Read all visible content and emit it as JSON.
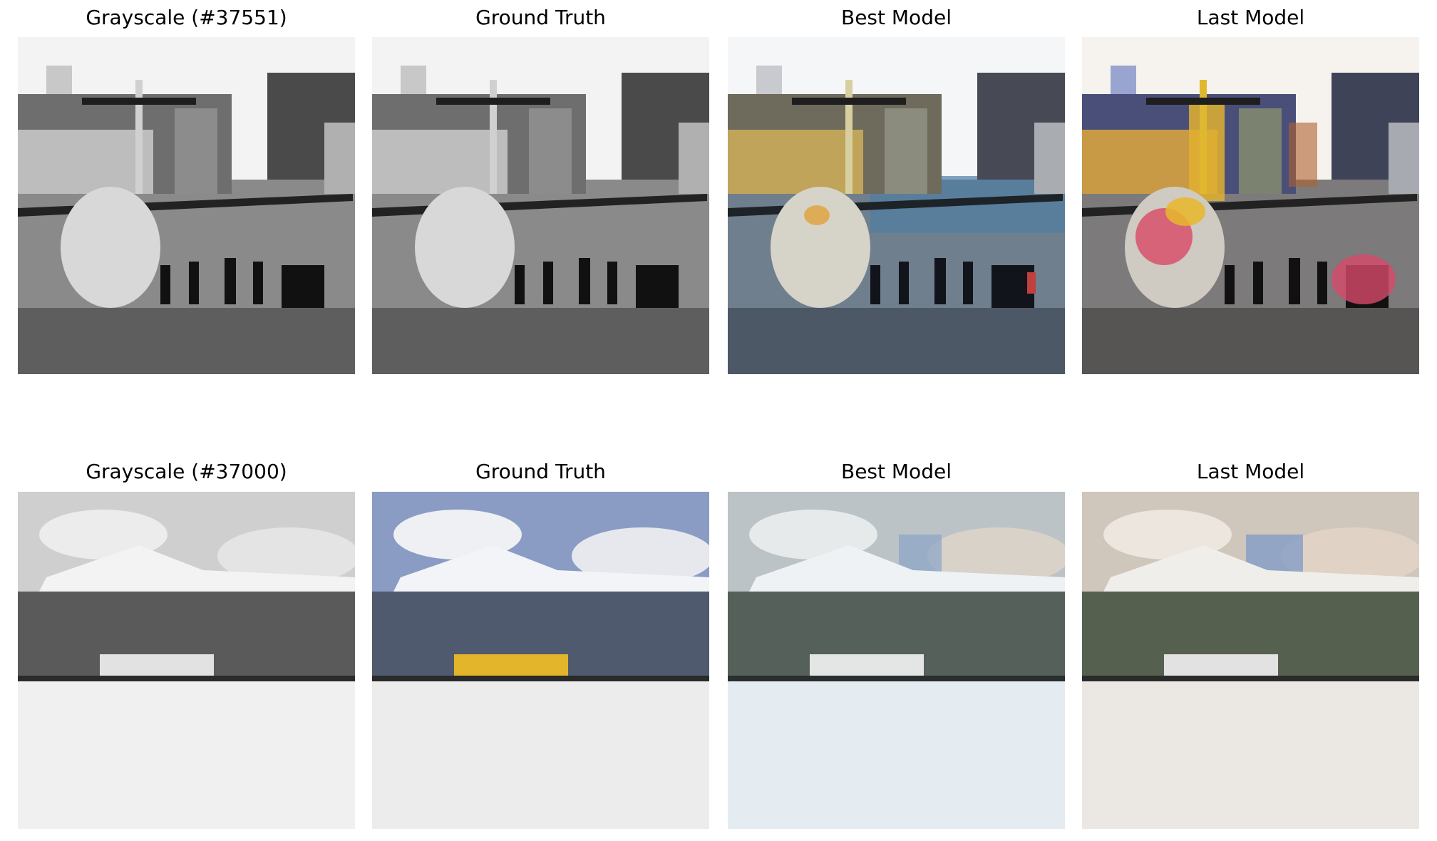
{
  "rows": [
    {
      "panels": [
        {
          "title": "Grayscale (#37551)",
          "variant": "gray"
        },
        {
          "title": "Ground Truth",
          "variant": "gray"
        },
        {
          "title": "Best Model",
          "variant": "best"
        },
        {
          "title": "Last Model",
          "variant": "last"
        }
      ]
    },
    {
      "panels": [
        {
          "title": "Grayscale (#37000)",
          "variant": "gray"
        },
        {
          "title": "Ground Truth",
          "variant": "truth"
        },
        {
          "title": "Best Model",
          "variant": "best"
        },
        {
          "title": "Last Model",
          "variant": "last"
        }
      ]
    }
  ]
}
